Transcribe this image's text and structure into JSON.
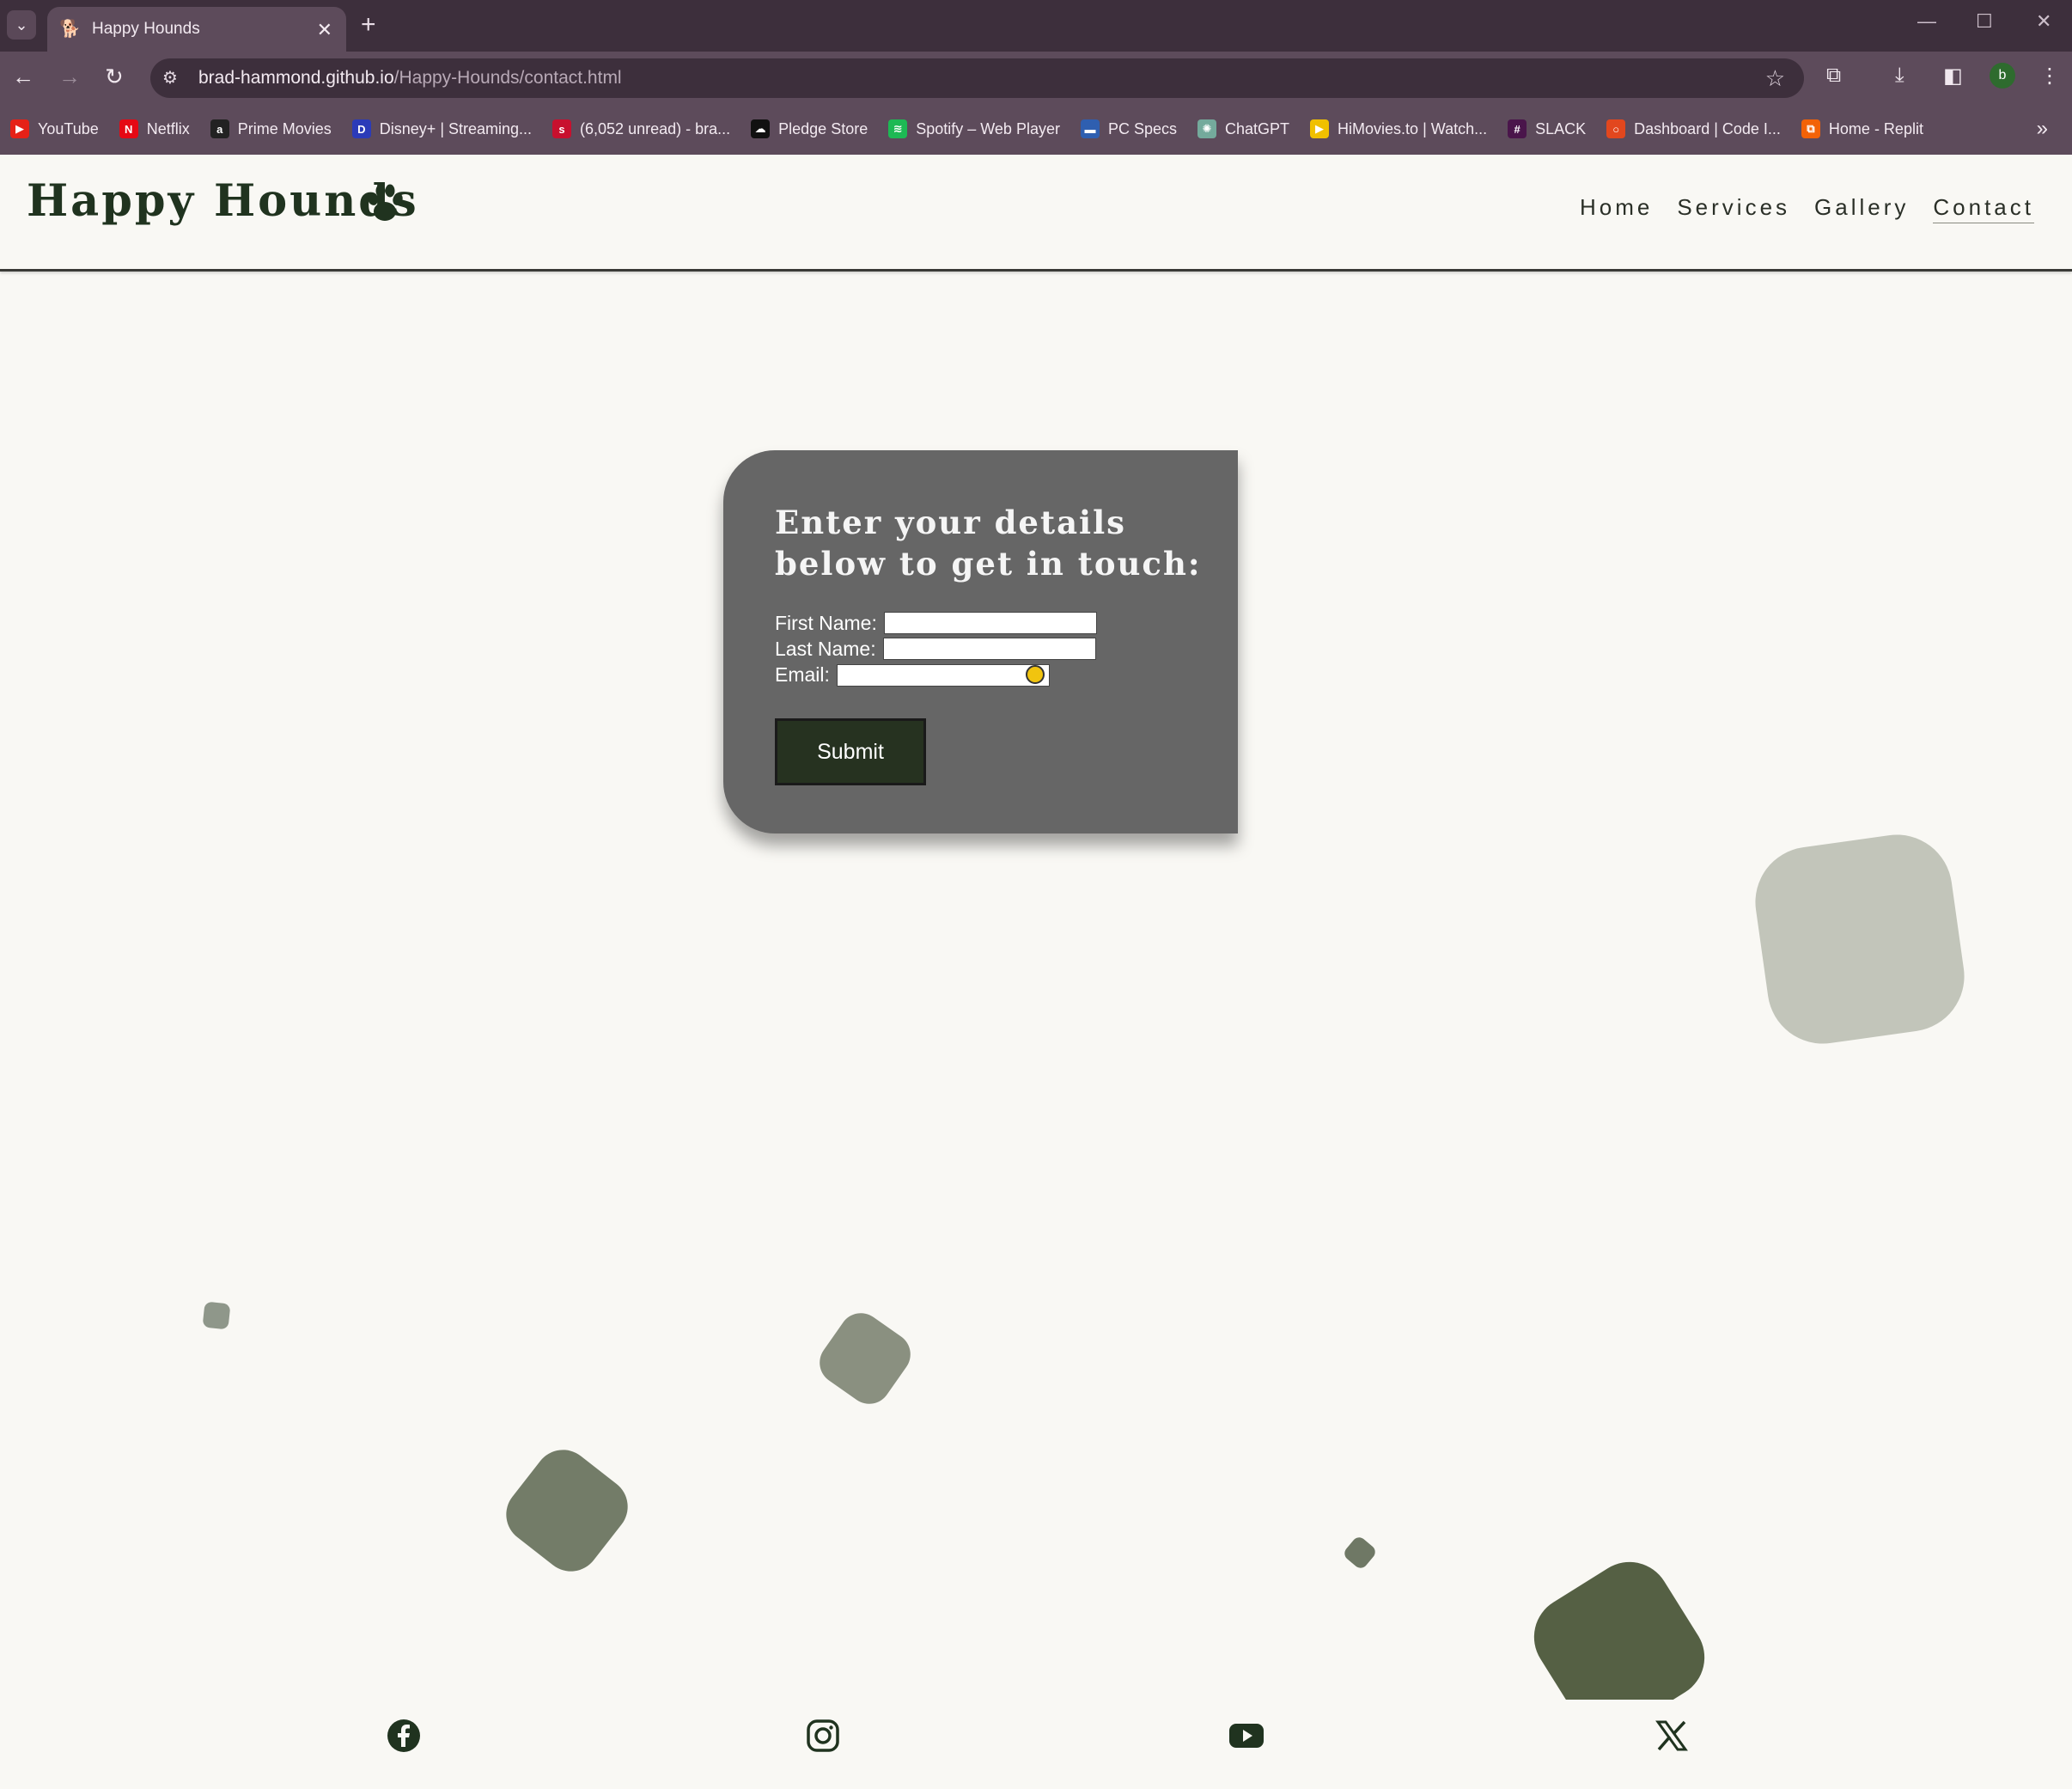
{
  "browser": {
    "tab_title": "Happy Hounds",
    "url_domain": "brad-hammond.github.io",
    "url_path": "/Happy-Hounds/contact.html",
    "profile_initial": "b",
    "bookmarks": [
      {
        "label": "YouTube",
        "icon": "youtube-icon",
        "color": "#e62117",
        "glyph": "▶"
      },
      {
        "label": "Netflix",
        "icon": "netflix-icon",
        "color": "#e50914",
        "glyph": "N"
      },
      {
        "label": "Prime Movies",
        "icon": "amazon-icon",
        "color": "#222222",
        "glyph": "a"
      },
      {
        "label": "Disney+ | Streaming...",
        "icon": "disney-icon",
        "color": "#2b3bb8",
        "glyph": "D"
      },
      {
        "label": "(6,052 unread) - bra...",
        "icon": "sky-mail-icon",
        "color": "#c8102e",
        "glyph": "s"
      },
      {
        "label": "Pledge Store",
        "icon": "cloud-store-icon",
        "color": "#111111",
        "glyph": "☁"
      },
      {
        "label": "Spotify – Web Player",
        "icon": "spotify-icon",
        "color": "#1db954",
        "glyph": "≋"
      },
      {
        "label": "PC Specs",
        "icon": "pc-specs-icon",
        "color": "#2f5fb0",
        "glyph": "▬"
      },
      {
        "label": "ChatGPT",
        "icon": "chatgpt-icon",
        "color": "#74aa9c",
        "glyph": "✺"
      },
      {
        "label": "HiMovies.to | Watch...",
        "icon": "himovies-icon",
        "color": "#f0c000",
        "glyph": "▶"
      },
      {
        "label": "SLACK",
        "icon": "slack-icon",
        "color": "#4a154b",
        "glyph": "#"
      },
      {
        "label": "Dashboard | Code I...",
        "icon": "codeinstitute-icon",
        "color": "#e2471e",
        "glyph": "○"
      },
      {
        "label": "Home - Replit",
        "icon": "replit-icon",
        "color": "#f26207",
        "glyph": "⧉"
      }
    ]
  },
  "site": {
    "logo_text": "Happy Hounds",
    "nav": [
      {
        "label": "Home",
        "active": false
      },
      {
        "label": "Services",
        "active": false
      },
      {
        "label": "Gallery",
        "active": false
      },
      {
        "label": "Contact",
        "active": true
      }
    ]
  },
  "form": {
    "heading": "Enter your details below to get in touch:",
    "first_name_label": "First Name:",
    "last_name_label": "Last Name:",
    "email_label": "Email:",
    "first_name_value": "",
    "last_name_value": "",
    "email_value": "",
    "submit_label": "Submit"
  },
  "footer": {
    "social": [
      "facebook-icon",
      "instagram-icon",
      "youtube-icon",
      "x-icon"
    ]
  },
  "colors": {
    "page_bg": "#f9f8f4",
    "card_bg": "#666666",
    "brand_green": "#20331f",
    "button_bg": "#263220"
  }
}
